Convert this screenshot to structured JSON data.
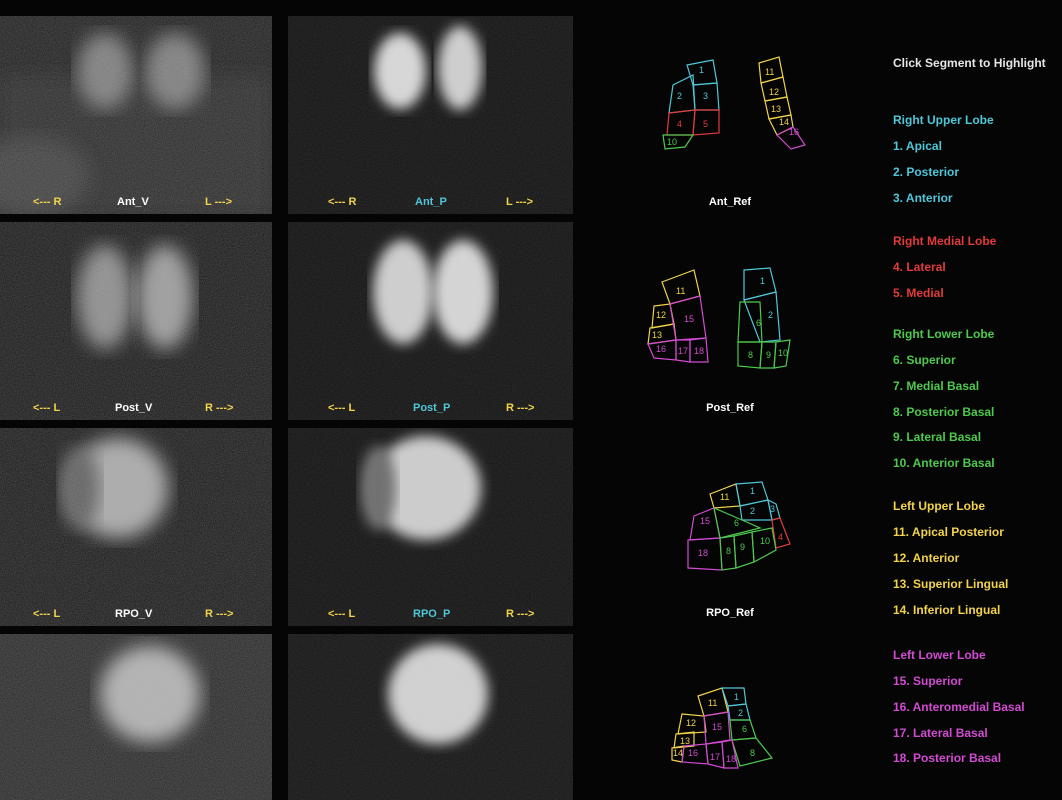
{
  "colors": {
    "yellow": "#f2d34b",
    "cyan": "#4fc7d9",
    "red": "#e23b3b",
    "green": "#4ec94e",
    "magenta": "#d24bd2",
    "white": "#ffffff"
  },
  "header": {
    "instruction": "Click Segment to Highlight"
  },
  "panels": {
    "ant_v": {
      "left": "<--- R",
      "center": "Ant_V",
      "right": "L --->"
    },
    "ant_p": {
      "left": "<--- R",
      "center": "Ant_P",
      "right": "L --->"
    },
    "post_v": {
      "left": "<--- L",
      "center": "Post_V",
      "right": "R --->"
    },
    "post_p": {
      "left": "<--- L",
      "center": "Post_P",
      "right": "R --->"
    },
    "rpo_v": {
      "left": "<--- L",
      "center": "RPO_V",
      "right": "R --->"
    },
    "rpo_p": {
      "left": "<--- L",
      "center": "RPO_P",
      "right": "R --->"
    }
  },
  "refs": {
    "ant": "Ant_Ref",
    "post": "Post_Ref",
    "rpo": "RPO_Ref"
  },
  "segment_numbers": [
    "1",
    "2",
    "3",
    "4",
    "5",
    "6",
    "7",
    "8",
    "9",
    "10",
    "11",
    "12",
    "13",
    "14",
    "15",
    "16",
    "17",
    "18"
  ],
  "legend": {
    "rul": {
      "title": "Right Upper Lobe",
      "items": [
        "1. Apical",
        "2. Posterior",
        "3. Anterior"
      ]
    },
    "rml": {
      "title": "Right Medial Lobe",
      "items": [
        "4. Lateral",
        "5. Medial"
      ]
    },
    "rll": {
      "title": "Right Lower Lobe",
      "items": [
        "6. Superior",
        "7. Medial Basal",
        "8. Posterior Basal",
        "9. Lateral Basal",
        "10. Anterior Basal"
      ]
    },
    "lul": {
      "title": "Left Upper Lobe",
      "items": [
        "11. Apical Posterior",
        "12. Anterior",
        "13. Superior Lingual",
        "14. Inferior Lingual"
      ]
    },
    "lll": {
      "title": "Left Lower Lobe",
      "items": [
        "15. Superior",
        "16. Anteromedial Basal",
        "17. Lateral Basal",
        "18. Posterior Basal"
      ]
    }
  }
}
